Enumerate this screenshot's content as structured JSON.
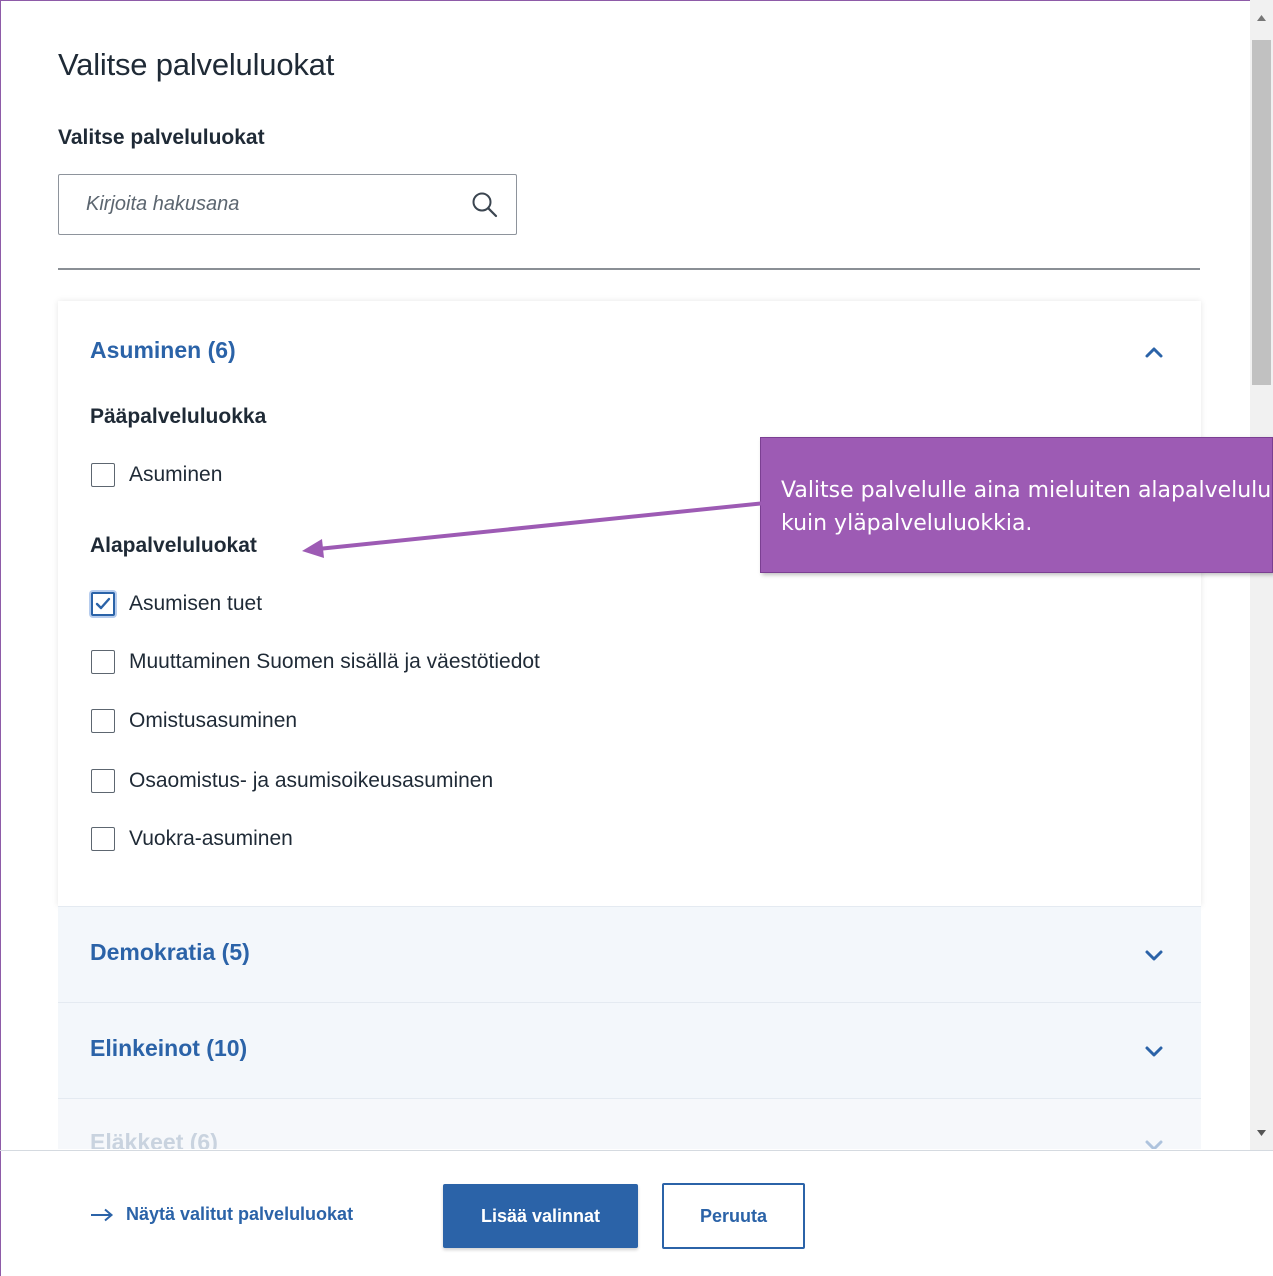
{
  "dialog": {
    "title": "Valitse palveluluokat",
    "field_label": "Valitse palveluluokat",
    "search_placeholder": "Kirjoita hakusana"
  },
  "accordion": [
    {
      "title": "Asuminen (6)",
      "expanded": true,
      "main_group_label": "Pääpalveluluokka",
      "main_options": [
        {
          "label": "Asuminen",
          "checked": false
        }
      ],
      "sub_group_label": "Alapalveluluokat",
      "sub_options": [
        {
          "label": "Asumisen tuet",
          "checked": true
        },
        {
          "label": "Muuttaminen Suomen sisällä ja väestötiedot",
          "checked": false
        },
        {
          "label": "Omistusasuminen",
          "checked": false
        },
        {
          "label": "Osaomistus- ja asumisoikeusasuminen",
          "checked": false
        },
        {
          "label": "Vuokra-asuminen",
          "checked": false
        }
      ]
    },
    {
      "title": "Demokratia (5)",
      "expanded": false
    },
    {
      "title": "Elinkeinot (10)",
      "expanded": false
    },
    {
      "title": "Eläkkeet (6)",
      "expanded": false
    }
  ],
  "footer": {
    "show_selected_label": "Näytä valitut palveluluokat",
    "add_label": "Lisää valinnat",
    "cancel_label": "Peruuta"
  },
  "callout": {
    "text": "Valitse palvelulle aina mieluiten alapalveluluokkia\nkuin yläpalveluluokkia."
  },
  "colors": {
    "accent": "#2b63a8",
    "callout": "#9d5bb4",
    "text": "#1f2a36"
  }
}
